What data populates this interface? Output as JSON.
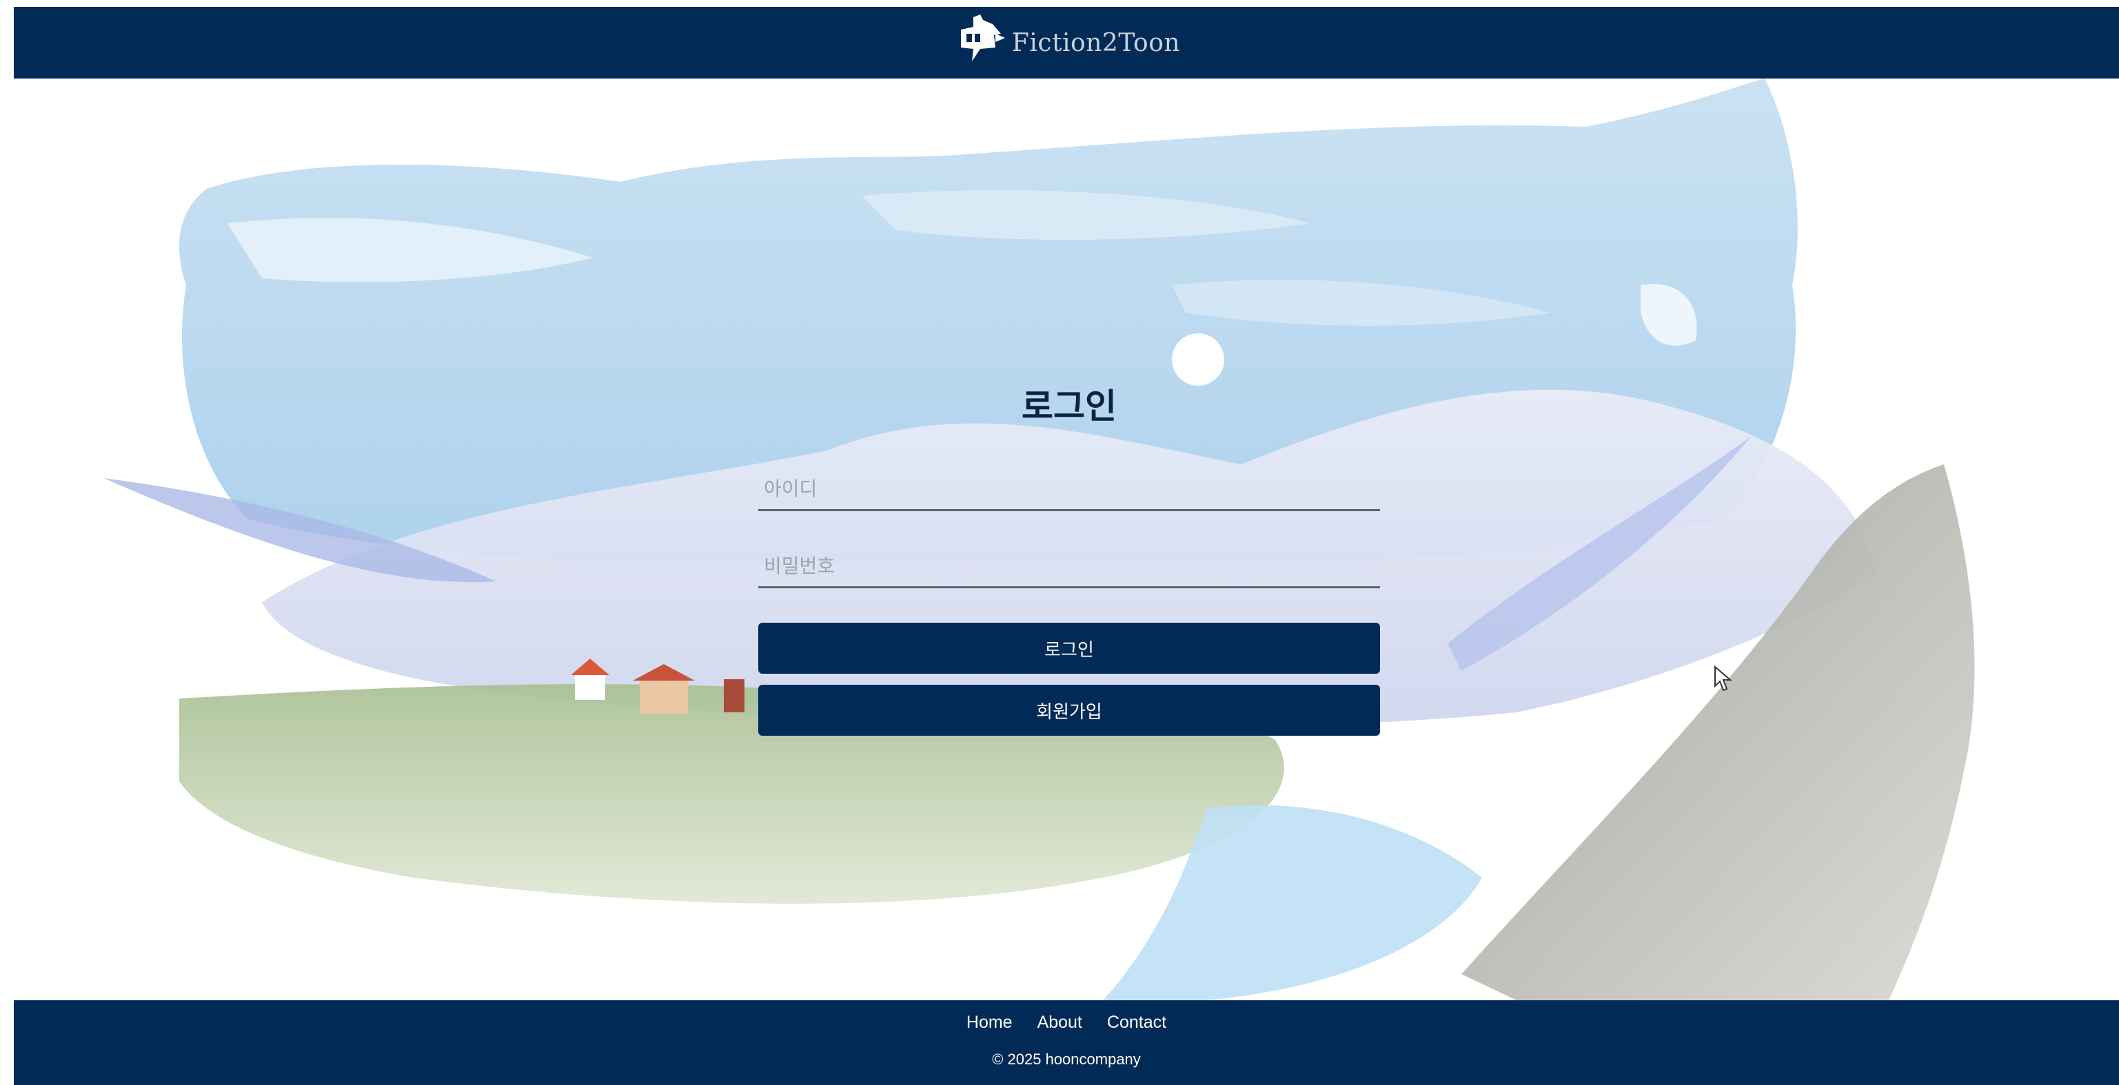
{
  "header": {
    "brand": "Fiction2Toon",
    "logo_icon": "speech-bubble-robot-icon",
    "bg_color": "#022a56"
  },
  "login": {
    "title": "로그인",
    "id_placeholder": "아이디",
    "password_placeholder": "비밀번호",
    "login_button": "로그인",
    "signup_button": "회원가입"
  },
  "footer": {
    "links": [
      "Home",
      "About",
      "Contact"
    ],
    "copyright": "© 2025 hooncompany"
  },
  "colors": {
    "navy": "#022a56",
    "sky": "#b9d9f0",
    "mountain": "#dfe3f2"
  }
}
